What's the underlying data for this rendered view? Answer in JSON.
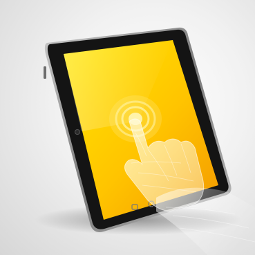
{
  "illustration": {
    "subject": "tablet-touch",
    "icons": [
      "tablet-icon",
      "touch-ripple-icon",
      "hand-icon",
      "home-button-icon",
      "sensor-dot-icon"
    ],
    "colors": {
      "background_light": "#ffffff",
      "background_dark": "#d3d3d3",
      "bezel": "#151515",
      "frame": "#9a9a9a",
      "screen_light": "#ffe000",
      "screen_dark": "#f49c00",
      "hand": "#fff4c8"
    }
  }
}
